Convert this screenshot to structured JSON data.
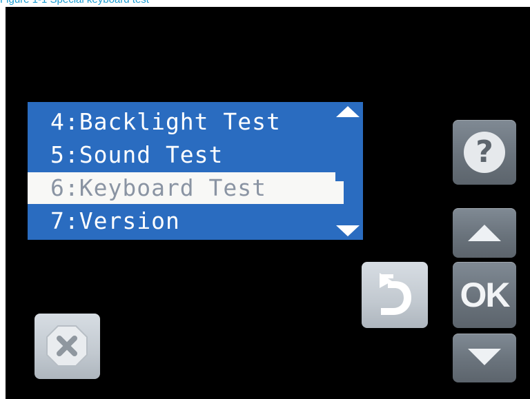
{
  "caption": "Figure 1-1 Special keyboard test",
  "lcd": {
    "menu_items": [
      {
        "label": "4:Backlight Test",
        "selected": false
      },
      {
        "label": "5:Sound Test",
        "selected": false
      },
      {
        "label": "6:Keyboard Test",
        "selected": true
      },
      {
        "label": "7:Version",
        "selected": false
      }
    ],
    "has_scroll_up": true,
    "has_scroll_down": true
  },
  "buttons": {
    "help_glyph": "?",
    "ok_label": "OK",
    "help_icon": "question-mark-icon",
    "up_icon": "triangle-up-icon",
    "down_icon": "triangle-down-icon",
    "back_icon": "back-arrow-icon",
    "cancel_icon": "x-octagon-icon"
  },
  "colors": {
    "lcd_background": "#2a6cc0",
    "selected_row_background": "#f8f8f6",
    "selected_row_text": "#8a94a3",
    "panel_background": "#000000",
    "caption_color": "#1a9bd1"
  }
}
